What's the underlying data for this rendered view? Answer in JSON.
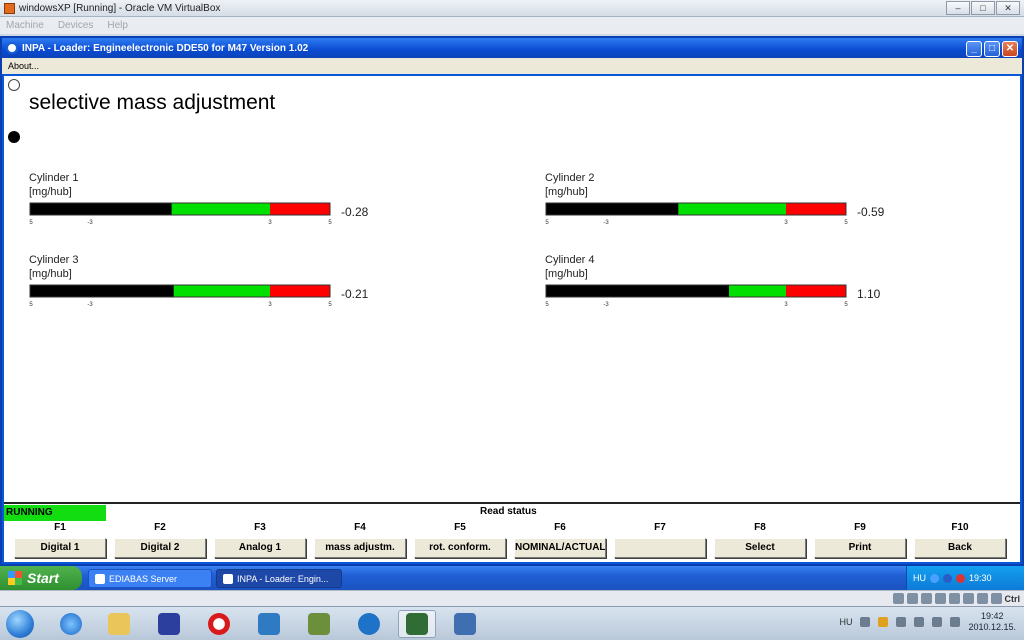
{
  "vbox": {
    "title": "windowsXP [Running] - Oracle VM VirtualBox",
    "menu": [
      "Machine",
      "Devices",
      "Help"
    ]
  },
  "inpa": {
    "title": "INPA - Loader:  Engineelectronic DDE50 for M47 Version 1.02",
    "menu_about": "About...",
    "page_title": "selective mass adjustment",
    "cylinders": [
      {
        "name": "Cylinder 1",
        "unit": "[mg/hub]",
        "value": "-0.28",
        "numeric": -0.28
      },
      {
        "name": "Cylinder 2",
        "unit": "[mg/hub]",
        "value": "-0.59",
        "numeric": -0.59
      },
      {
        "name": "Cylinder 3",
        "unit": "[mg/hub]",
        "value": "-0.21",
        "numeric": -0.21
      },
      {
        "name": "Cylinder 4",
        "unit": "[mg/hub]",
        "value": "1.10",
        "numeric": 1.1
      }
    ],
    "scale_ticks": [
      "-5",
      "-3",
      "3",
      "5"
    ],
    "scale": {
      "min": -5,
      "max": 5,
      "zones": [
        [
          -5,
          -3,
          "#ff0000"
        ],
        [
          -3,
          3,
          "#00e000"
        ],
        [
          3,
          5,
          "#ff0000"
        ]
      ]
    },
    "status": "RUNNING",
    "read_status": "Read status",
    "fkeys": [
      "F1",
      "F2",
      "F3",
      "F4",
      "F5",
      "F6",
      "F7",
      "F8",
      "F9",
      "F10"
    ],
    "fbuttons": [
      "Digital 1",
      "Digital 2",
      "Analog 1",
      "mass adjustm.",
      "rot. conform.",
      "NOMINAL/ACTUAL",
      "",
      "Select",
      "Print",
      "Back"
    ]
  },
  "xp_taskbar": {
    "start": "Start",
    "items": [
      "EDIABAS Server",
      "INPA - Loader:  Engin..."
    ],
    "lang": "HU",
    "time": "19:30"
  },
  "vbox_status": {
    "host_key": "Ctrl"
  },
  "w7_taskbar": {
    "lang": "HU",
    "time": "19:42",
    "date": "2010.12.15."
  }
}
